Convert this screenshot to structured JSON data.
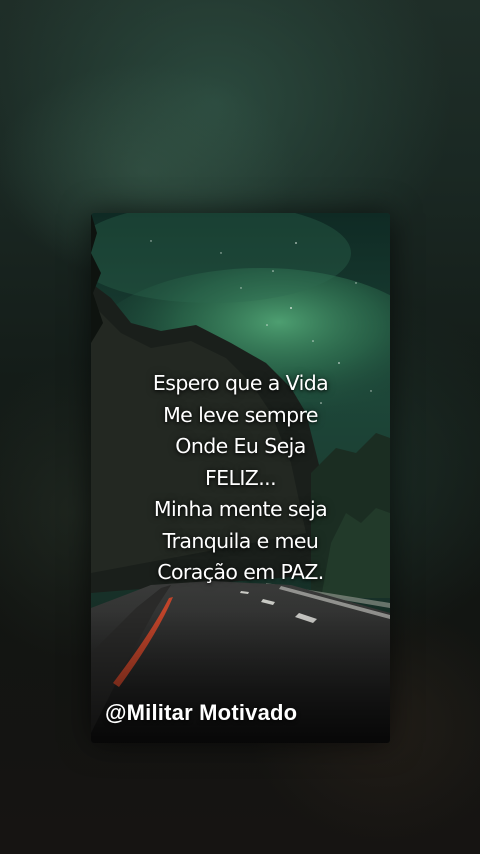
{
  "quote": {
    "lines": [
      "Espero que a Vida",
      "Me leve sempre",
      "Onde Eu Seja",
      "FELIZ...",
      "Minha mente seja",
      "Tranquila e meu",
      "Coração em PAZ."
    ]
  },
  "watermark": "@Militar Motivado",
  "colors": {
    "aurora": "#3f8a62",
    "sky": "#1c3a30",
    "road": "#262626",
    "road_edge_line": "#c0442a",
    "text": "#ffffff"
  }
}
